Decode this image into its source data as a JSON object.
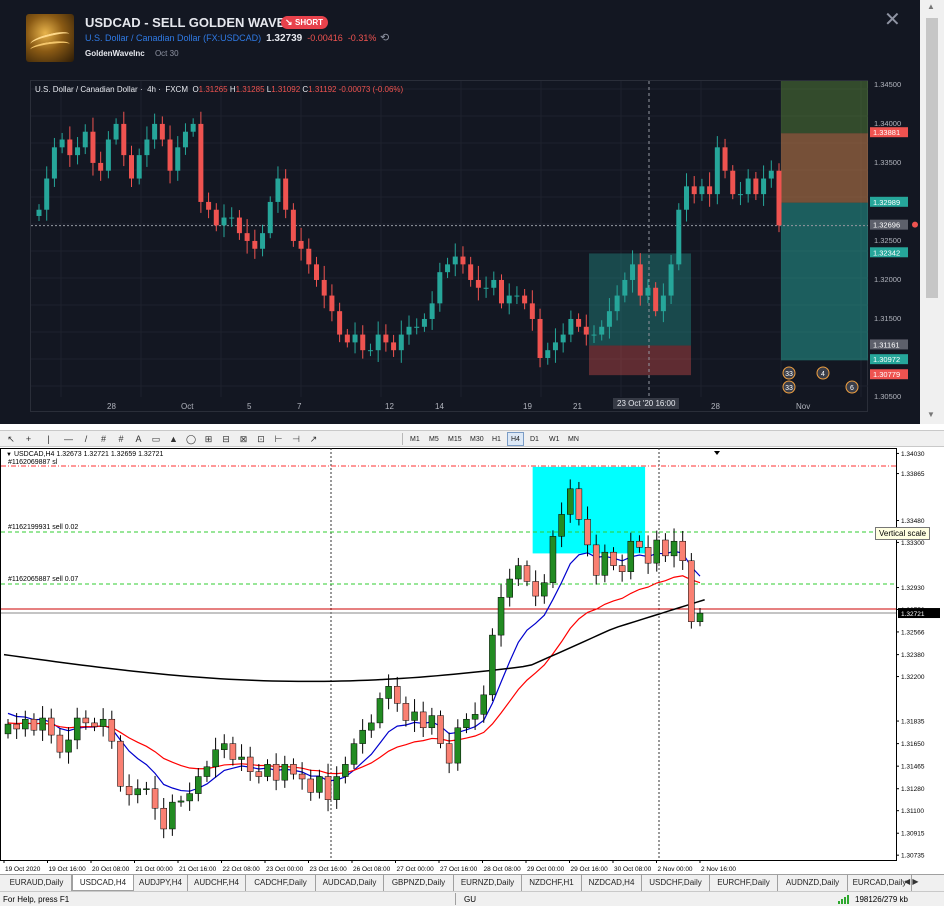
{
  "tv": {
    "title": "USDCAD - SELL GOLDEN WAVE INC",
    "badge": "SHORT",
    "symbol_name": "U.S. Dollar / Canadian Dollar",
    "symbol_ticker": "(FX:USDCAD)",
    "price": "1.32739",
    "change": "-0.00416",
    "change_pct": "-0.31%",
    "author": "GoldenWaveInc",
    "date": "Oct 30",
    "legend_name": "U.S. Dollar / Canadian Dollar",
    "legend_tf": "4h",
    "legend_src": "FXCM",
    "legend_o_label": "O",
    "legend_o": "1.31265",
    "legend_h_label": "H",
    "legend_h": "1.31285",
    "legend_l_label": "L",
    "legend_l": "1.31092",
    "legend_c_label": "C",
    "legend_c": "1.31192",
    "legend_chg": "-0.00073 (-0.06%)",
    "x_labels": [
      "28",
      "Oct",
      "5",
      "7",
      "12",
      "14",
      "19",
      "21",
      "23 Oct '20  16:00",
      "28",
      "Nov"
    ],
    "y_labels": [
      "1.34500",
      "1.34000",
      "1.33500",
      "1.32500",
      "1.32000",
      "1.31500",
      "1.30500"
    ],
    "price_tags": [
      {
        "label": "1.33881",
        "color": "#ef5350"
      },
      {
        "label": "1.32989",
        "color": "#26a69a"
      },
      {
        "label": "1.32696",
        "color": "#5d606b"
      },
      {
        "label": "1.32342",
        "color": "#26a69a"
      },
      {
        "label": "1.31161",
        "color": "#5d606b"
      },
      {
        "label": "1.30972",
        "color": "#26a69a"
      },
      {
        "label": "1.30779",
        "color": "#ef5350"
      }
    ],
    "event_badges": [
      "33",
      "33",
      "4",
      "6"
    ],
    "up_color": "#26a69a",
    "down_color": "#ef5350",
    "chart_data": {
      "type": "candlestick",
      "timeframe": "4h",
      "ylim": [
        1.305,
        1.3455
      ],
      "close_approx": [
        1.329,
        1.333,
        1.337,
        1.338,
        1.336,
        1.337,
        1.339,
        1.335,
        1.334,
        1.338,
        1.34,
        1.336,
        1.333,
        1.336,
        1.338,
        1.34,
        1.338,
        1.334,
        1.337,
        1.339,
        1.34,
        1.33,
        1.329,
        1.327,
        1.328,
        1.328,
        1.326,
        1.325,
        1.324,
        1.326,
        1.33,
        1.333,
        1.329,
        1.325,
        1.324,
        1.322,
        1.32,
        1.318,
        1.316,
        1.313,
        1.312,
        1.313,
        1.311,
        1.311,
        1.313,
        1.312,
        1.311,
        1.313,
        1.314,
        1.314,
        1.315,
        1.317,
        1.321,
        1.322,
        1.323,
        1.322,
        1.32,
        1.319,
        1.319,
        1.32,
        1.317,
        1.318,
        1.318,
        1.317,
        1.315,
        1.31,
        1.311,
        1.312,
        1.313,
        1.315,
        1.314,
        1.313,
        1.313,
        1.314,
        1.316,
        1.318,
        1.32,
        1.322,
        1.318,
        1.319,
        1.316,
        1.318,
        1.322,
        1.329,
        1.332,
        1.331,
        1.332,
        1.331,
        1.337,
        1.334,
        1.331,
        1.331,
        1.333,
        1.331,
        1.333,
        1.334,
        1.327
      ],
      "trade_box_1": {
        "entry": 1.3116,
        "stop": 1.3078,
        "target": 1.3234
      },
      "trade_box_2": {
        "entry": 1.3299,
        "stop": 1.3388,
        "target": 1.3097
      }
    }
  },
  "toolbar": {
    "tools": [
      "↖",
      "+",
      "|",
      "—",
      "/",
      "#",
      "#",
      "A",
      "▭",
      "▲",
      "◯",
      "⊞",
      "⊟",
      "⊠",
      "⊡",
      "⊢",
      "⊣",
      "↗"
    ],
    "timeframes": [
      "M1",
      "M5",
      "M15",
      "M30",
      "H1",
      "H4",
      "D1",
      "W1",
      "MN"
    ],
    "selected_timeframe": "H4"
  },
  "mt": {
    "info": "USDCAD,H4  1.32673 1.32721 1.32659 1.32721",
    "order_sl": "#1162069887 sl",
    "order_sell1": "#1162199931 sell 0.02",
    "order_sell2": "#1162065887 sell 0.07",
    "tooltip": "Vertical scale",
    "current_price": "1.32721",
    "y_labels": [
      "1.34030",
      "1.33865",
      "1.33480",
      "1.33300",
      "1.32930",
      "1.32750",
      "1.32566",
      "1.32380",
      "1.32200",
      "1.31835",
      "1.31650",
      "1.31465",
      "1.31280",
      "1.31100",
      "1.30915",
      "1.30735"
    ],
    "x_labels": [
      "19 Oct 2020",
      "19 Oct 16:00",
      "20 Oct 08:00",
      "21 Oct 00:00",
      "21 Oct 16:00",
      "22 Oct 08:00",
      "23 Oct 00:00",
      "23 Oct 16:00",
      "26 Oct 08:00",
      "27 Oct 00:00",
      "27 Oct 16:00",
      "28 Oct 08:00",
      "29 Oct 00:00",
      "29 Oct 16:00",
      "30 Oct 08:00",
      "2 Nov 00:00",
      "2 Nov 16:00"
    ],
    "colors": {
      "bull": "#228b22",
      "bear": "#fa8072",
      "ma_fast": "#0000cd",
      "ma_mid": "#ff0000",
      "ma_slow": "#000000",
      "box": "#00ffff"
    },
    "chart_data": {
      "type": "candlestick",
      "timeframe": "H4",
      "ylim": [
        1.3072,
        1.3405
      ],
      "close_approx": [
        1.3181,
        1.3177,
        1.3185,
        1.3176,
        1.3186,
        1.3172,
        1.3158,
        1.3168,
        1.3186,
        1.3182,
        1.3179,
        1.3185,
        1.3167,
        1.313,
        1.3123,
        1.3128,
        1.3128,
        1.3112,
        1.3095,
        1.3117,
        1.3118,
        1.3124,
        1.3138,
        1.3146,
        1.316,
        1.3165,
        1.3152,
        1.3154,
        1.3142,
        1.3138,
        1.3148,
        1.3135,
        1.3148,
        1.314,
        1.3136,
        1.3125,
        1.3138,
        1.3119,
        1.3138,
        1.3148,
        1.3165,
        1.3176,
        1.3182,
        1.3202,
        1.3212,
        1.3198,
        1.3184,
        1.3191,
        1.3178,
        1.3188,
        1.3165,
        1.3149,
        1.3178,
        1.3185,
        1.3189,
        1.3205,
        1.3254,
        1.3285,
        1.33,
        1.3311,
        1.3298,
        1.3286,
        1.3297,
        1.3335,
        1.3353,
        1.3374,
        1.3349,
        1.3328,
        1.3303,
        1.3322,
        1.3311,
        1.3306,
        1.3331,
        1.3326,
        1.3313,
        1.3332,
        1.3319,
        1.3331,
        1.3315,
        1.3265,
        1.3272
      ]
    }
  },
  "tabs": [
    "EURAUD,Daily",
    "USDCAD,H4",
    "AUDJPY,H4",
    "AUDCHF,H4",
    "CADCHF,Daily",
    "AUDCAD,Daily",
    "GBPNZD,Daily",
    "EURNZD,Daily",
    "NZDCHF,H1",
    "NZDCAD,H4",
    "USDCHF,Daily",
    "EURCHF,Daily",
    "AUDNZD,Daily",
    "EURCAD,Daily"
  ],
  "selected_tab": "USDCAD,H4",
  "status": {
    "help": "For Help, press F1",
    "profile": "GU",
    "traffic": "198126/279 kb"
  }
}
